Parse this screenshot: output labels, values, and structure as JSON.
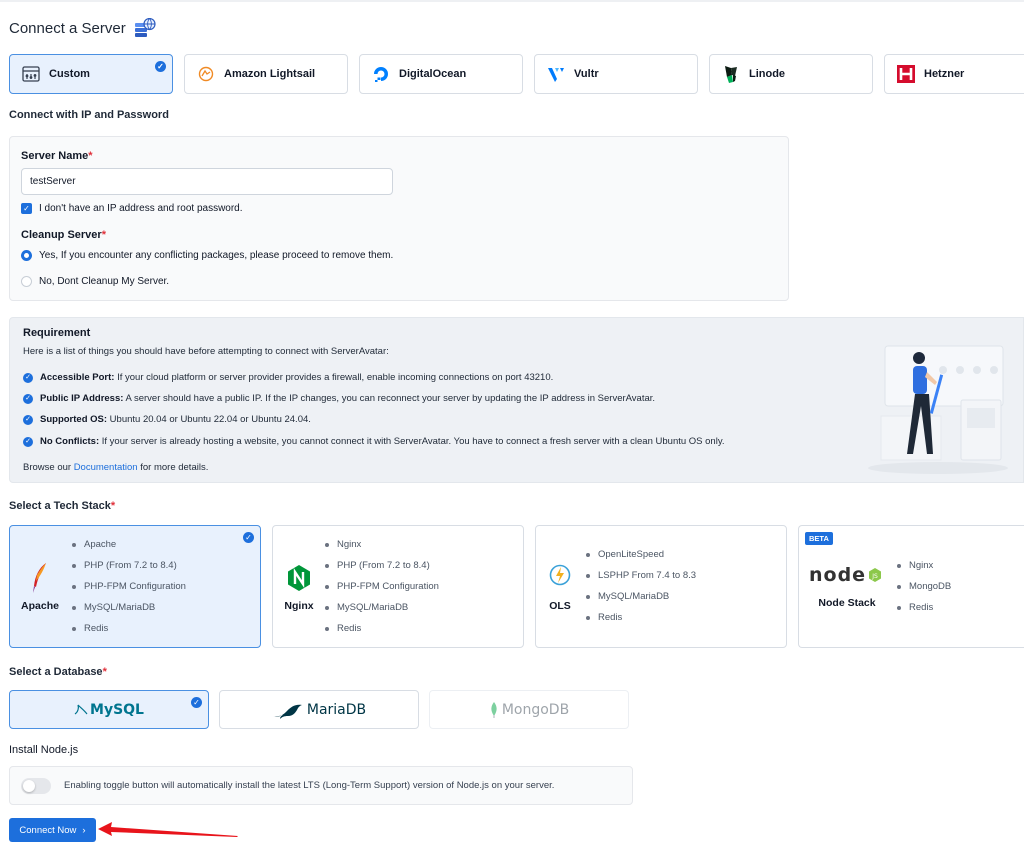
{
  "page": {
    "title": "Connect a Server"
  },
  "providers": [
    {
      "label": "Custom",
      "selected": true,
      "icon": "custom-server-icon"
    },
    {
      "label": "Amazon Lightsail",
      "selected": false,
      "icon": "lightsail-icon"
    },
    {
      "label": "DigitalOcean",
      "selected": false,
      "icon": "digitalocean-icon"
    },
    {
      "label": "Vultr",
      "selected": false,
      "icon": "vultr-icon"
    },
    {
      "label": "Linode",
      "selected": false,
      "icon": "linode-icon"
    },
    {
      "label": "Hetzner",
      "selected": false,
      "icon": "hetzner-icon"
    }
  ],
  "connect_section": {
    "title": "Connect with IP and Password"
  },
  "form": {
    "server_name_label": "Server Name",
    "server_name_value": "testServer",
    "no_ip_checkbox_label": "I don't have an IP address and root password.",
    "no_ip_checked": true,
    "cleanup_label": "Cleanup Server",
    "cleanup_options": [
      {
        "label": "Yes, If you encounter any conflicting packages, please proceed to remove them.",
        "selected": true
      },
      {
        "label": "No, Dont Cleanup My Server.",
        "selected": false
      }
    ]
  },
  "requirement": {
    "title": "Requirement",
    "subtitle": "Here is a list of things you should have before attempting to connect with ServerAvatar:",
    "items": [
      {
        "bold": "Accessible Port:",
        "text": " If your cloud platform or server provider provides a firewall, enable incoming connections on port 43210."
      },
      {
        "bold": "Public IP Address:",
        "text": " A server should have a public IP. If the IP changes, you can reconnect your server by updating the IP address in ServerAvatar."
      },
      {
        "bold": "Supported OS:",
        "text": " Ubuntu 20.04 or Ubuntu 22.04 or Ubuntu 24.04."
      },
      {
        "bold": "No Conflicts:",
        "text": " If your server is already hosting a website, you cannot connect it with ServerAvatar. You have to connect a fresh server with a clean Ubuntu OS only."
      }
    ],
    "footer_prefix": "Browse our ",
    "footer_link": "Documentation",
    "footer_suffix": " for more details."
  },
  "tech_stack": {
    "title": "Select a Tech Stack",
    "stacks": [
      {
        "name": "Apache",
        "selected": true,
        "beta": false,
        "features": [
          "Apache",
          "PHP (From 7.2 to 8.4)",
          "PHP-FPM Configuration",
          "MySQL/MariaDB",
          "Redis"
        ]
      },
      {
        "name": "Nginx",
        "selected": false,
        "beta": false,
        "features": [
          "Nginx",
          "PHP (From 7.2 to 8.4)",
          "PHP-FPM Configuration",
          "MySQL/MariaDB",
          "Redis"
        ]
      },
      {
        "name": "OLS",
        "selected": false,
        "beta": false,
        "features": [
          "OpenLiteSpeed",
          "LSPHP From 7.4 to 8.3",
          "MySQL/MariaDB",
          "Redis"
        ]
      },
      {
        "name": "Node Stack",
        "selected": false,
        "beta": true,
        "beta_label": "BETA",
        "logo_text": "node",
        "features": [
          "Nginx",
          "MongoDB",
          "Redis"
        ]
      }
    ]
  },
  "database": {
    "title": "Select a Database",
    "options": [
      {
        "label": "MySQL",
        "selected": true
      },
      {
        "label": "MariaDB",
        "selected": false
      },
      {
        "label": "MongoDB",
        "selected": false,
        "disabled": true
      }
    ]
  },
  "node": {
    "title": "Install Node.js",
    "toggle_on": false,
    "description": "Enabling toggle button will automatically install the latest LTS (Long-Term Support) version of Node.js on your server."
  },
  "actions": {
    "connect_label": "Connect Now"
  },
  "colors": {
    "accent": "#1d6fdc",
    "selected_bg": "#e8f1fd",
    "required": "#e0303a",
    "annotation_arrow": "#e8141b"
  }
}
